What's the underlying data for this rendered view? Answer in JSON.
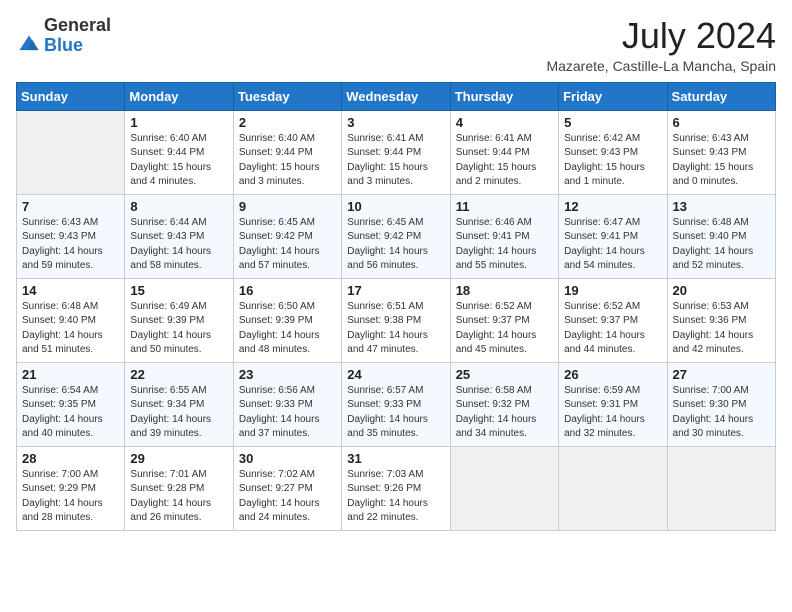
{
  "logo": {
    "general": "General",
    "blue": "Blue"
  },
  "title": "July 2024",
  "location": "Mazarete, Castille-La Mancha, Spain",
  "days_of_week": [
    "Sunday",
    "Monday",
    "Tuesday",
    "Wednesday",
    "Thursday",
    "Friday",
    "Saturday"
  ],
  "weeks": [
    [
      {
        "day": "",
        "empty": true
      },
      {
        "day": "1",
        "sunrise": "Sunrise: 6:40 AM",
        "sunset": "Sunset: 9:44 PM",
        "daylight": "Daylight: 15 hours and 4 minutes."
      },
      {
        "day": "2",
        "sunrise": "Sunrise: 6:40 AM",
        "sunset": "Sunset: 9:44 PM",
        "daylight": "Daylight: 15 hours and 3 minutes."
      },
      {
        "day": "3",
        "sunrise": "Sunrise: 6:41 AM",
        "sunset": "Sunset: 9:44 PM",
        "daylight": "Daylight: 15 hours and 3 minutes."
      },
      {
        "day": "4",
        "sunrise": "Sunrise: 6:41 AM",
        "sunset": "Sunset: 9:44 PM",
        "daylight": "Daylight: 15 hours and 2 minutes."
      },
      {
        "day": "5",
        "sunrise": "Sunrise: 6:42 AM",
        "sunset": "Sunset: 9:43 PM",
        "daylight": "Daylight: 15 hours and 1 minute."
      },
      {
        "day": "6",
        "sunrise": "Sunrise: 6:43 AM",
        "sunset": "Sunset: 9:43 PM",
        "daylight": "Daylight: 15 hours and 0 minutes."
      }
    ],
    [
      {
        "day": "7",
        "sunrise": "Sunrise: 6:43 AM",
        "sunset": "Sunset: 9:43 PM",
        "daylight": "Daylight: 14 hours and 59 minutes."
      },
      {
        "day": "8",
        "sunrise": "Sunrise: 6:44 AM",
        "sunset": "Sunset: 9:43 PM",
        "daylight": "Daylight: 14 hours and 58 minutes."
      },
      {
        "day": "9",
        "sunrise": "Sunrise: 6:45 AM",
        "sunset": "Sunset: 9:42 PM",
        "daylight": "Daylight: 14 hours and 57 minutes."
      },
      {
        "day": "10",
        "sunrise": "Sunrise: 6:45 AM",
        "sunset": "Sunset: 9:42 PM",
        "daylight": "Daylight: 14 hours and 56 minutes."
      },
      {
        "day": "11",
        "sunrise": "Sunrise: 6:46 AM",
        "sunset": "Sunset: 9:41 PM",
        "daylight": "Daylight: 14 hours and 55 minutes."
      },
      {
        "day": "12",
        "sunrise": "Sunrise: 6:47 AM",
        "sunset": "Sunset: 9:41 PM",
        "daylight": "Daylight: 14 hours and 54 minutes."
      },
      {
        "day": "13",
        "sunrise": "Sunrise: 6:48 AM",
        "sunset": "Sunset: 9:40 PM",
        "daylight": "Daylight: 14 hours and 52 minutes."
      }
    ],
    [
      {
        "day": "14",
        "sunrise": "Sunrise: 6:48 AM",
        "sunset": "Sunset: 9:40 PM",
        "daylight": "Daylight: 14 hours and 51 minutes."
      },
      {
        "day": "15",
        "sunrise": "Sunrise: 6:49 AM",
        "sunset": "Sunset: 9:39 PM",
        "daylight": "Daylight: 14 hours and 50 minutes."
      },
      {
        "day": "16",
        "sunrise": "Sunrise: 6:50 AM",
        "sunset": "Sunset: 9:39 PM",
        "daylight": "Daylight: 14 hours and 48 minutes."
      },
      {
        "day": "17",
        "sunrise": "Sunrise: 6:51 AM",
        "sunset": "Sunset: 9:38 PM",
        "daylight": "Daylight: 14 hours and 47 minutes."
      },
      {
        "day": "18",
        "sunrise": "Sunrise: 6:52 AM",
        "sunset": "Sunset: 9:37 PM",
        "daylight": "Daylight: 14 hours and 45 minutes."
      },
      {
        "day": "19",
        "sunrise": "Sunrise: 6:52 AM",
        "sunset": "Sunset: 9:37 PM",
        "daylight": "Daylight: 14 hours and 44 minutes."
      },
      {
        "day": "20",
        "sunrise": "Sunrise: 6:53 AM",
        "sunset": "Sunset: 9:36 PM",
        "daylight": "Daylight: 14 hours and 42 minutes."
      }
    ],
    [
      {
        "day": "21",
        "sunrise": "Sunrise: 6:54 AM",
        "sunset": "Sunset: 9:35 PM",
        "daylight": "Daylight: 14 hours and 40 minutes."
      },
      {
        "day": "22",
        "sunrise": "Sunrise: 6:55 AM",
        "sunset": "Sunset: 9:34 PM",
        "daylight": "Daylight: 14 hours and 39 minutes."
      },
      {
        "day": "23",
        "sunrise": "Sunrise: 6:56 AM",
        "sunset": "Sunset: 9:33 PM",
        "daylight": "Daylight: 14 hours and 37 minutes."
      },
      {
        "day": "24",
        "sunrise": "Sunrise: 6:57 AM",
        "sunset": "Sunset: 9:33 PM",
        "daylight": "Daylight: 14 hours and 35 minutes."
      },
      {
        "day": "25",
        "sunrise": "Sunrise: 6:58 AM",
        "sunset": "Sunset: 9:32 PM",
        "daylight": "Daylight: 14 hours and 34 minutes."
      },
      {
        "day": "26",
        "sunrise": "Sunrise: 6:59 AM",
        "sunset": "Sunset: 9:31 PM",
        "daylight": "Daylight: 14 hours and 32 minutes."
      },
      {
        "day": "27",
        "sunrise": "Sunrise: 7:00 AM",
        "sunset": "Sunset: 9:30 PM",
        "daylight": "Daylight: 14 hours and 30 minutes."
      }
    ],
    [
      {
        "day": "28",
        "sunrise": "Sunrise: 7:00 AM",
        "sunset": "Sunset: 9:29 PM",
        "daylight": "Daylight: 14 hours and 28 minutes."
      },
      {
        "day": "29",
        "sunrise": "Sunrise: 7:01 AM",
        "sunset": "Sunset: 9:28 PM",
        "daylight": "Daylight: 14 hours and 26 minutes."
      },
      {
        "day": "30",
        "sunrise": "Sunrise: 7:02 AM",
        "sunset": "Sunset: 9:27 PM",
        "daylight": "Daylight: 14 hours and 24 minutes."
      },
      {
        "day": "31",
        "sunrise": "Sunrise: 7:03 AM",
        "sunset": "Sunset: 9:26 PM",
        "daylight": "Daylight: 14 hours and 22 minutes."
      },
      {
        "day": "",
        "empty": true
      },
      {
        "day": "",
        "empty": true
      },
      {
        "day": "",
        "empty": true
      }
    ]
  ]
}
